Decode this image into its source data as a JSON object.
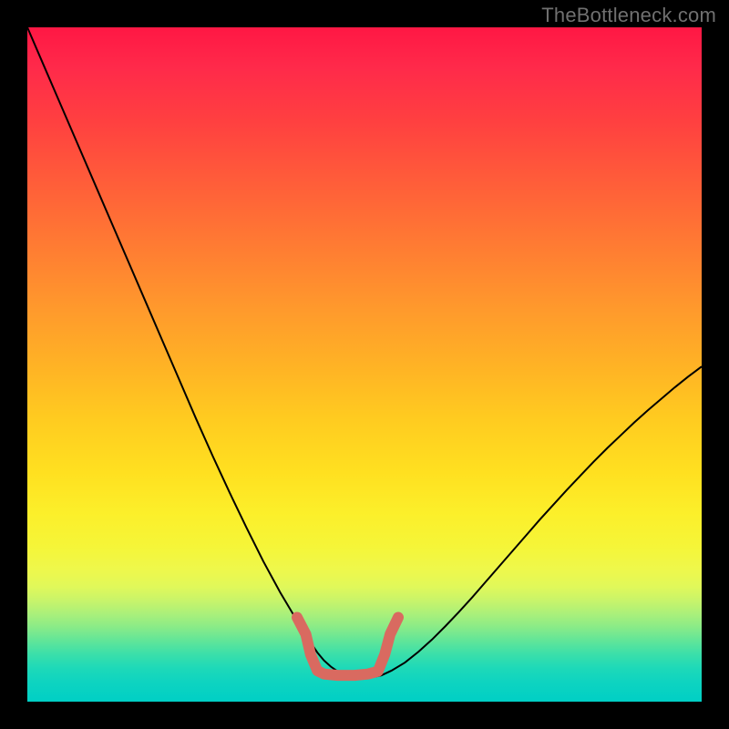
{
  "watermark": "TheBottleneck.com",
  "chart_data": {
    "type": "line",
    "title": "",
    "xlabel": "",
    "ylabel": "",
    "xlim": [
      0,
      100
    ],
    "ylim": [
      0,
      100
    ],
    "grid": false,
    "legend": false,
    "gradient_stops": [
      {
        "pos": 0,
        "color": "#ff1744"
      },
      {
        "pos": 50,
        "color": "#ffb225"
      },
      {
        "pos": 75,
        "color": "#fcef2a"
      },
      {
        "pos": 90,
        "color": "#60e599"
      },
      {
        "pos": 100,
        "color": "#00cfc5"
      }
    ],
    "series": [
      {
        "name": "bottleneck-curve",
        "stroke": "#000000",
        "stroke_width": 2,
        "x": [
          0,
          2.5,
          5,
          7.5,
          10,
          12.5,
          15,
          17.5,
          20,
          22.5,
          25,
          27.5,
          30,
          32.5,
          35,
          37.5,
          40,
          41.5,
          43,
          44,
          45,
          46,
          47,
          48,
          49.5,
          51,
          52.5,
          54,
          56,
          58,
          60,
          62,
          64,
          66,
          68,
          70,
          72,
          74,
          76,
          78,
          80,
          82,
          84,
          86,
          88,
          90,
          92,
          94,
          96,
          98,
          100
        ],
        "y": [
          100,
          94.2,
          88.4,
          82.6,
          76.8,
          71,
          65.2,
          59.4,
          53.6,
          47.8,
          42,
          36.4,
          31,
          25.8,
          20.8,
          16.2,
          12,
          9.5,
          7.3,
          6.1,
          5.2,
          4.5,
          4,
          3.7,
          3.5,
          3.6,
          3.9,
          4.6,
          5.8,
          7.4,
          9.2,
          11.2,
          13.3,
          15.5,
          17.8,
          20.1,
          22.4,
          24.7,
          27,
          29.2,
          31.4,
          33.5,
          35.6,
          37.6,
          39.5,
          41.4,
          43.2,
          44.9,
          46.6,
          48.2,
          49.7
        ]
      },
      {
        "name": "optimal-range-marker",
        "stroke": "#d96a60",
        "stroke_width": 12,
        "linecap": "round",
        "x": [
          40.0,
          41.3,
          42.0,
          43.0,
          44.0,
          46.0,
          48.5,
          50.5,
          52.0,
          53.0,
          53.8,
          55.0
        ],
        "y": [
          12.5,
          10.0,
          7.0,
          4.6,
          4.1,
          3.9,
          3.9,
          4.1,
          4.5,
          7.0,
          10.0,
          12.5
        ]
      }
    ]
  }
}
